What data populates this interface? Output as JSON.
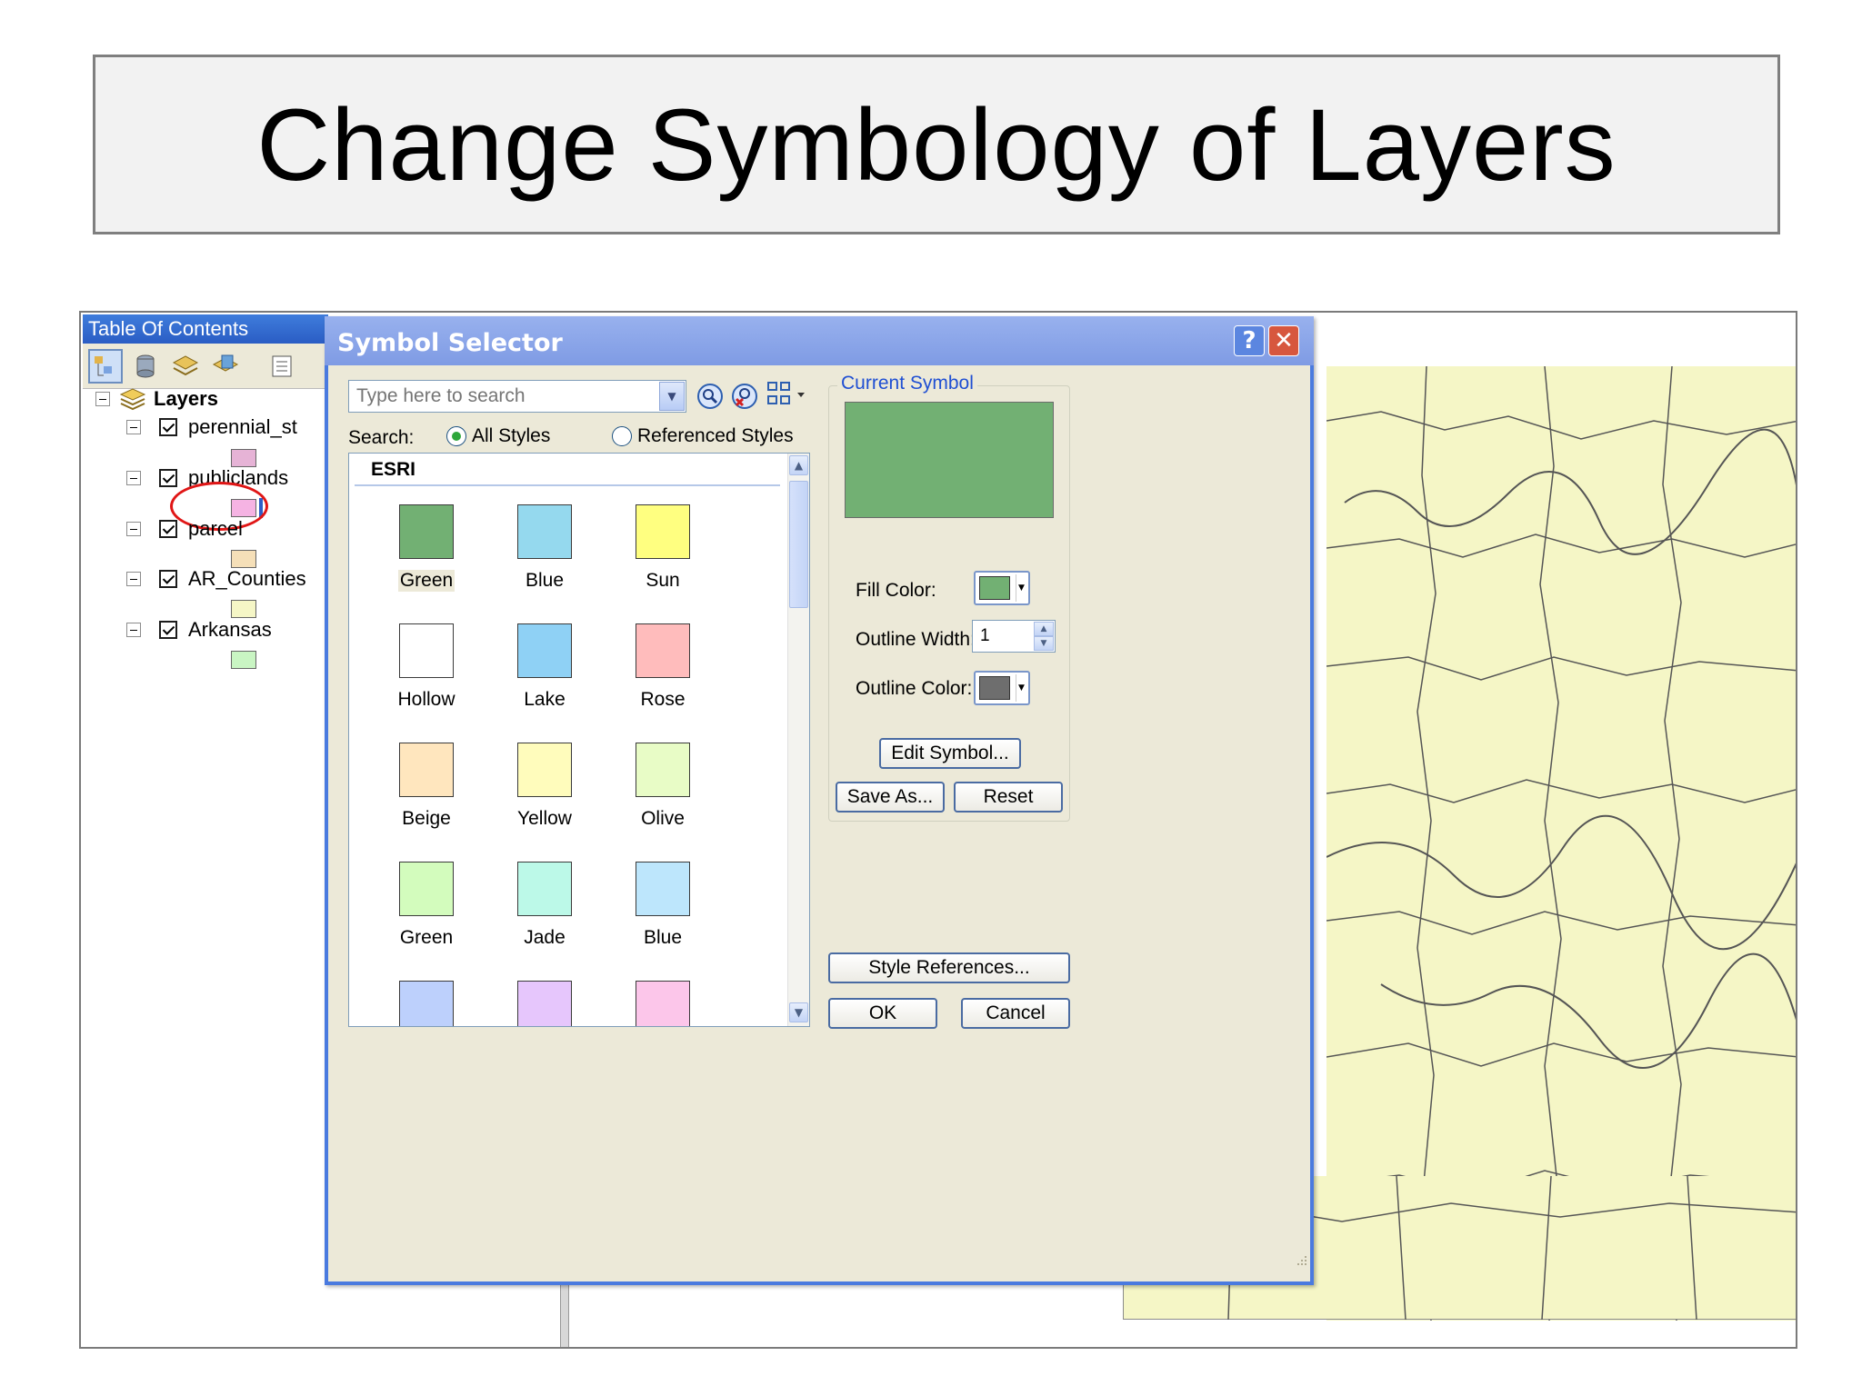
{
  "slide": {
    "title": "Change Symbology of Layers"
  },
  "toc": {
    "title": "Table Of Contents",
    "root_label": "Layers",
    "layers": [
      {
        "name": "perennial_st",
        "swatch": "#e6b3d6"
      },
      {
        "name": "publiclands",
        "swatch": "#f5b3e3"
      },
      {
        "name": "parcel",
        "swatch": "#f5dfb8"
      },
      {
        "name": "AR_Counties",
        "swatch": "#f5f6c6"
      },
      {
        "name": "Arkansas",
        "swatch": "#c9f5c3"
      }
    ]
  },
  "dialog": {
    "title": "Symbol Selector",
    "help_label": "?",
    "close_label": "✕",
    "search_placeholder": "Type here to search",
    "search_label": "Search:",
    "all_styles_label": "All Styles",
    "referenced_styles_label": "Referenced Styles",
    "gallery_header": "ESRI",
    "symbols": [
      {
        "label": "Green",
        "color": "#72b073",
        "selected": true
      },
      {
        "label": "Blue",
        "color": "#95d9ee"
      },
      {
        "label": "Sun",
        "color": "#ffff80"
      },
      {
        "label": "Hollow",
        "color": "#ffffff"
      },
      {
        "label": "Lake",
        "color": "#8fd1f5"
      },
      {
        "label": "Rose",
        "color": "#ffbcbc"
      },
      {
        "label": "Beige",
        "color": "#ffe6be"
      },
      {
        "label": "Yellow",
        "color": "#fffcbc"
      },
      {
        "label": "Olive",
        "color": "#e8fcc6"
      },
      {
        "label": "Green",
        "color": "#d3fcbd"
      },
      {
        "label": "Jade",
        "color": "#bcf9e8"
      },
      {
        "label": "Blue",
        "color": "#bde6fc"
      },
      {
        "label": "",
        "color": "#bdd0fc"
      },
      {
        "label": "",
        "color": "#e6c6fc"
      },
      {
        "label": "",
        "color": "#fcc6ea"
      }
    ],
    "current_symbol_label": "Current Symbol",
    "current_color": "#72b073",
    "fill_color_label": "Fill Color:",
    "fill_color": "#72b073",
    "outline_width_label": "Outline Width:",
    "outline_width_value": "1",
    "outline_color_label": "Outline Color:",
    "outline_color": "#6e6e6e",
    "edit_symbol_label": "Edit Symbol...",
    "save_as_label": "Save As...",
    "reset_label": "Reset",
    "style_references_label": "Style References...",
    "ok_label": "OK",
    "cancel_label": "Cancel"
  }
}
